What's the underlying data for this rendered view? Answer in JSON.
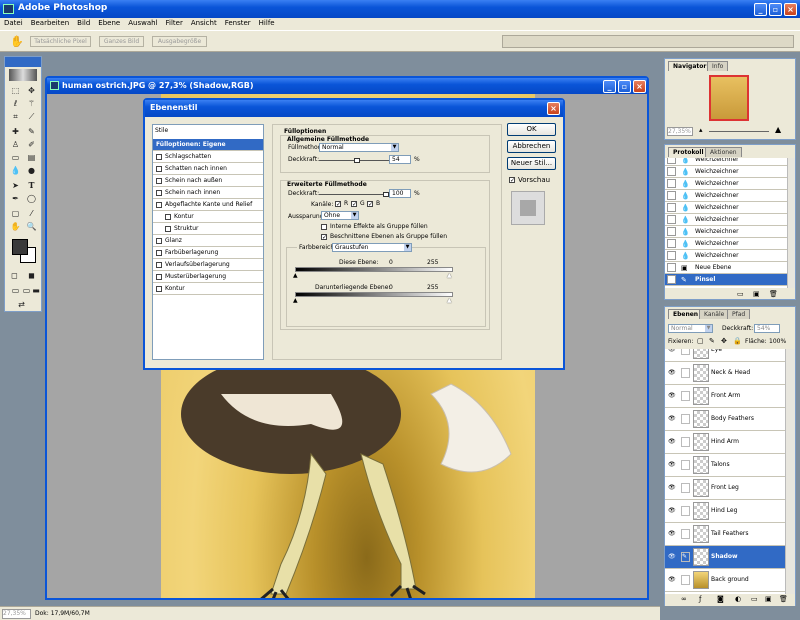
{
  "app": {
    "title": "Adobe Photoshop"
  },
  "menu": [
    "Datei",
    "Bearbeiten",
    "Bild",
    "Ebene",
    "Auswahl",
    "Filter",
    "Ansicht",
    "Fenster",
    "Hilfe"
  ],
  "options_bar": {
    "buttons": [
      "Tatsächliche Pixel",
      "Ganzes Bild",
      "Ausgabegröße"
    ]
  },
  "document": {
    "title": "human ostrich.JPG @ 27,3% (Shadow,RGB)"
  },
  "dialog": {
    "title": "Ebenenstil",
    "styles_header": "Stile",
    "styles": [
      {
        "label": "Fülloptionen: Eigene",
        "selected": true,
        "checkbox": false
      },
      {
        "label": "Schlagschatten",
        "checkbox": true
      },
      {
        "label": "Schatten nach innen",
        "checkbox": true
      },
      {
        "label": "Schein nach außen",
        "checkbox": true
      },
      {
        "label": "Schein nach innen",
        "checkbox": true
      },
      {
        "label": "Abgeflachte Kante und Relief",
        "checkbox": true
      },
      {
        "label": "Kontur",
        "checkbox": true,
        "sub": true
      },
      {
        "label": "Struktur",
        "checkbox": true,
        "sub": true
      },
      {
        "label": "Glanz",
        "checkbox": true
      },
      {
        "label": "Farbüberlagerung",
        "checkbox": true
      },
      {
        "label": "Verlaufsüberlagerung",
        "checkbox": true
      },
      {
        "label": "Musterüberlagerung",
        "checkbox": true
      },
      {
        "label": "Kontur",
        "checkbox": true
      }
    ],
    "blend": {
      "heading": "Fülloptionen",
      "general_heading": "Allgemeine Füllmethode",
      "mode_label": "Füllmethode:",
      "mode_value": "Normal",
      "opacity_label": "Deckkraft:",
      "opacity_value": "54",
      "opacity_fraction": 0.54,
      "percent": "%",
      "advanced_heading": "Erweiterte Füllmethode",
      "fill_opacity_label": "Deckkraft:",
      "fill_opacity_value": "100",
      "fill_opacity_fraction": 1.0,
      "channels_label": "Kanäle:",
      "channels": [
        "R",
        "G",
        "B"
      ],
      "knockout_label": "Aussparung:",
      "knockout_value": "Ohne",
      "option1": "Interne Effekte als Gruppe füllen",
      "option2": "Beschnittene Ebenen als Gruppe füllen",
      "blendif_label": "Farbbereich:",
      "blendif_value": "Graustufen",
      "this_layer_label": "Diese Ebene:",
      "this_layer_min": "0",
      "this_layer_max": "255",
      "under_layer_label": "Darunterliegende Ebene:",
      "under_layer_min": "0",
      "under_layer_max": "255"
    },
    "buttons": {
      "ok": "OK",
      "cancel": "Abbrechen",
      "new_style": "Neuer Stil...",
      "preview": "Vorschau"
    }
  },
  "navigator": {
    "tabs": [
      "Navigator",
      "Info"
    ],
    "zoom": "27,35%"
  },
  "history": {
    "tabs": [
      "Protokoll",
      "Aktionen"
    ],
    "items": [
      "Weichzeichner",
      "Weichzeichner",
      "Weichzeichner",
      "Weichzeichner",
      "Weichzeichner",
      "Weichzeichner",
      "Weichzeichner",
      "Weichzeichner",
      "Weichzeichner",
      "Neue Ebene",
      "Pinsel"
    ]
  },
  "layers": {
    "tabs": [
      "Ebenen",
      "Kanäle",
      "Pfad"
    ],
    "mode": "Normal",
    "opacity_label": "Deckkraft:",
    "opacity_value": "54%",
    "lock_label": "Fixieren:",
    "fill_label": "Fläche:",
    "fill_value": "100%",
    "items": [
      "Eye",
      "Neck & Head",
      "Front Arm",
      "Body Feathers",
      "Hind Arm",
      "Talons",
      "Front Leg",
      "Hind Leg",
      "Tail Feathers",
      "Shadow",
      "Back ground"
    ],
    "selected": "Shadow"
  },
  "status": {
    "zoom": "27,35%",
    "doc": "Dok: 17,9M/60,7M"
  },
  "colors": {
    "accent": "#316ac5",
    "titlebar": "#0a55d8",
    "panel": "#ece9d8",
    "workspace": "#7f8e9c"
  }
}
